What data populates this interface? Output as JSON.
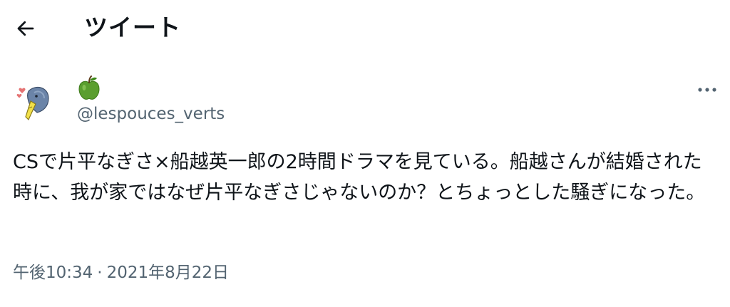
{
  "header": {
    "title": "ツイート",
    "back_icon": "arrow-left-icon"
  },
  "tweet": {
    "avatar_icon": "bird-avatar-icon",
    "display_name_icon": "green-apple-icon",
    "handle": "@lespouces_verts",
    "more_icon": "more-horizontal-icon",
    "text": "CSで片平なぎさ×船越英一郎の2時間ドラマを見ている。船越さんが結婚された時に、我が家ではなぜ片平なぎさじゃないのか？とちょっとした騒ぎになった。",
    "time": "午後10:34",
    "separator": "·",
    "date": "2021年8月22日"
  },
  "colors": {
    "text": "#0f1419",
    "secondary": "#536471",
    "apple": "#5a9e2f"
  }
}
